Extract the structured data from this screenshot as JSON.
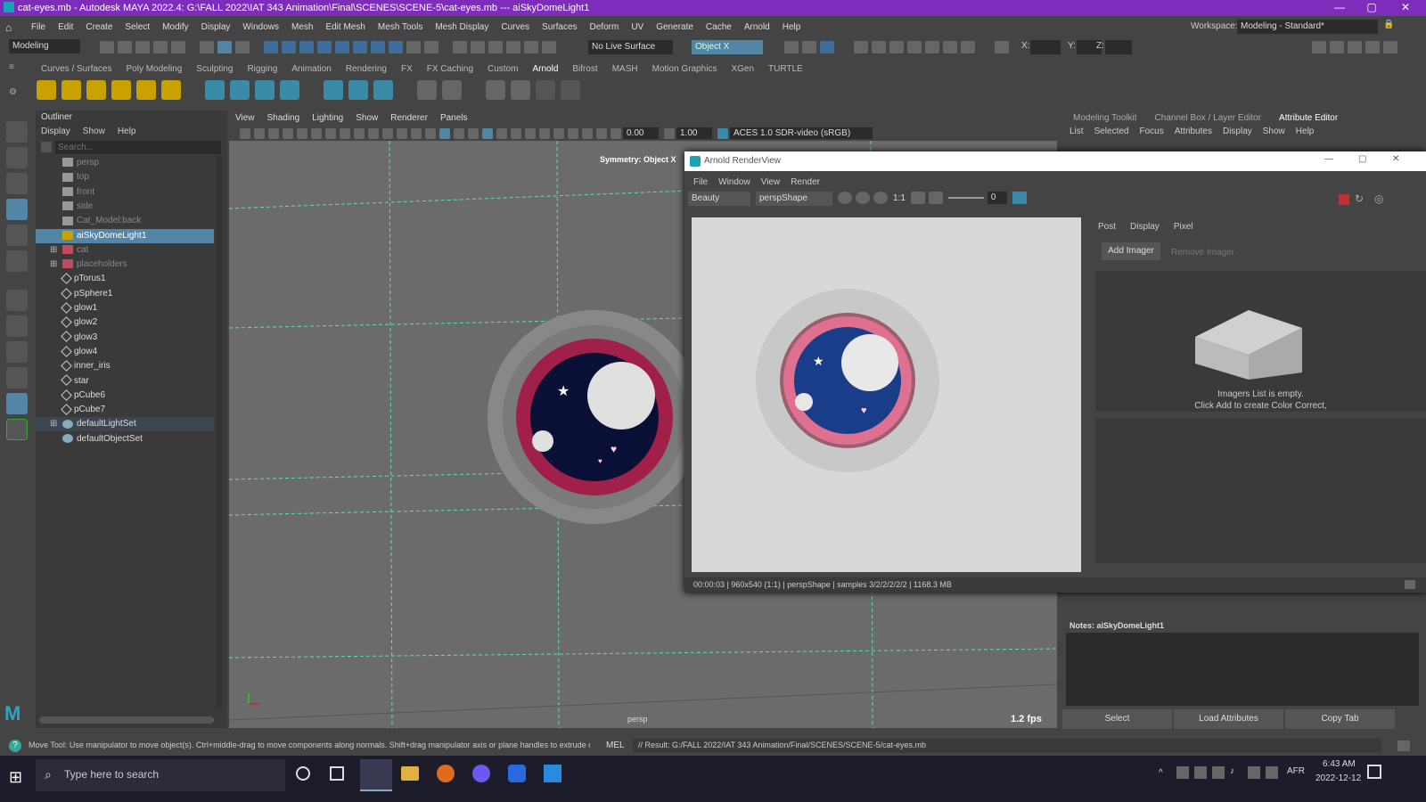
{
  "titlebar": {
    "title": "cat-eyes.mb - Autodesk MAYA 2022.4: G:\\FALL 2022\\IAT 343 Animation\\Final\\SCENES\\SCENE-5\\cat-eyes.mb  ---  aiSkyDomeLight1",
    "min": "—",
    "max": "▢",
    "close": "✕"
  },
  "menubar": {
    "items": [
      "File",
      "Edit",
      "Create",
      "Select",
      "Modify",
      "Display",
      "Windows",
      "Mesh",
      "Edit Mesh",
      "Mesh Tools",
      "Mesh Display",
      "Curves",
      "Surfaces",
      "Deform",
      "UV",
      "Generate",
      "Cache",
      "Arnold",
      "Help"
    ],
    "workspace_label": "Workspace:",
    "workspace_value": "Modeling - Standard*"
  },
  "toolbar": {
    "mode": "Modeling",
    "live_surface": "No Live Surface",
    "object_field": "Object X",
    "x_label": "X:",
    "y_label": "Y:",
    "z_label": "Z:"
  },
  "shelf": {
    "tabs": [
      "Curves / Surfaces",
      "Poly Modeling",
      "Sculpting",
      "Rigging",
      "Animation",
      "Rendering",
      "FX",
      "FX Caching",
      "Custom",
      "Arnold",
      "Bifrost",
      "MASH",
      "Motion Graphics",
      "XGen",
      "TURTLE"
    ],
    "active": "Arnold"
  },
  "outliner": {
    "title": "Outliner",
    "menu": [
      "Display",
      "Show",
      "Help"
    ],
    "search_placeholder": "Search...",
    "items": [
      {
        "label": "persp",
        "kind": "camera",
        "dim": true
      },
      {
        "label": "top",
        "kind": "camera",
        "dim": true
      },
      {
        "label": "front",
        "kind": "camera",
        "dim": true
      },
      {
        "label": "side",
        "kind": "camera",
        "dim": true
      },
      {
        "label": "Cat_Model:back",
        "kind": "camera",
        "dim": true
      },
      {
        "label": "aiSkyDomeLight1",
        "kind": "light",
        "sel": true
      },
      {
        "label": "cat",
        "kind": "group",
        "dim": true,
        "expand": true
      },
      {
        "label": "placeholders",
        "kind": "group",
        "dim": true,
        "expand": true
      },
      {
        "label": "pTorus1",
        "kind": "mesh"
      },
      {
        "label": "pSphere1",
        "kind": "mesh"
      },
      {
        "label": "glow1",
        "kind": "mesh"
      },
      {
        "label": "glow2",
        "kind": "mesh"
      },
      {
        "label": "glow3",
        "kind": "mesh"
      },
      {
        "label": "glow4",
        "kind": "mesh"
      },
      {
        "label": "inner_iris",
        "kind": "mesh"
      },
      {
        "label": "star",
        "kind": "mesh"
      },
      {
        "label": "pCube6",
        "kind": "mesh"
      },
      {
        "label": "pCube7",
        "kind": "mesh"
      },
      {
        "label": "defaultLightSet",
        "kind": "set",
        "expand": true,
        "set": true
      },
      {
        "label": "defaultObjectSet",
        "kind": "set"
      }
    ]
  },
  "viewport": {
    "menu": [
      "View",
      "Shading",
      "Lighting",
      "Show",
      "Renderer",
      "Panels"
    ],
    "val1": "0.00",
    "val2": "1.00",
    "colorspace": "ACES 1.0 SDR-video (sRGB)",
    "symmetry": "Symmetry: Object X",
    "camera": "persp",
    "fps": "1.2 fps"
  },
  "attr": {
    "tabs": [
      "Modeling Toolkit",
      "Channel Box / Layer Editor",
      "Attribute Editor"
    ],
    "active": "Attribute Editor",
    "menu": [
      "List",
      "Selected",
      "Focus",
      "Attributes",
      "Display",
      "Show",
      "Help"
    ],
    "notes": "Notes:  aiSkyDomeLight1",
    "buttons": [
      "Select",
      "Load Attributes",
      "Copy Tab"
    ]
  },
  "render": {
    "title": "Arnold RenderView",
    "menu": [
      "File",
      "Window",
      "View",
      "Render"
    ],
    "aov": "Beauty",
    "camera": "perspShape",
    "ratio": "1:1",
    "exposure": "0",
    "tabs": [
      "Post",
      "Display",
      "Pixel"
    ],
    "add_imager": "Add Imager",
    "remove_imager": "Remove Imager",
    "empty1": "Imagers List is empty.",
    "empty2": "Click Add to create Color Correct,",
    "status": "00:00:03 | 960x540 (1:1) | perspShape | samples 3/2/2/2/2/2 | 1168.3 MB"
  },
  "statusbar": {
    "help": "Move Tool: Use manipulator to move object(s). Ctrl+middle-drag to move components along normals. Shift+drag manipulator axis or plane handles to extrude components o",
    "lang": "MEL",
    "result": "// Result: G:/FALL 2022/IAT 343 Animation/Final/SCENES/SCENE-5/cat-eyes.mb"
  },
  "taskbar": {
    "search": "Type here to search",
    "time": "6:43 AM",
    "date": "2022-12-12",
    "lang": "AFR"
  },
  "colors": {
    "title": "#7e2cbb",
    "selection": "#5285a6",
    "iris_outer": "#a0204a",
    "iris_pink": "#e07090",
    "pupil": "#0a0f35"
  }
}
